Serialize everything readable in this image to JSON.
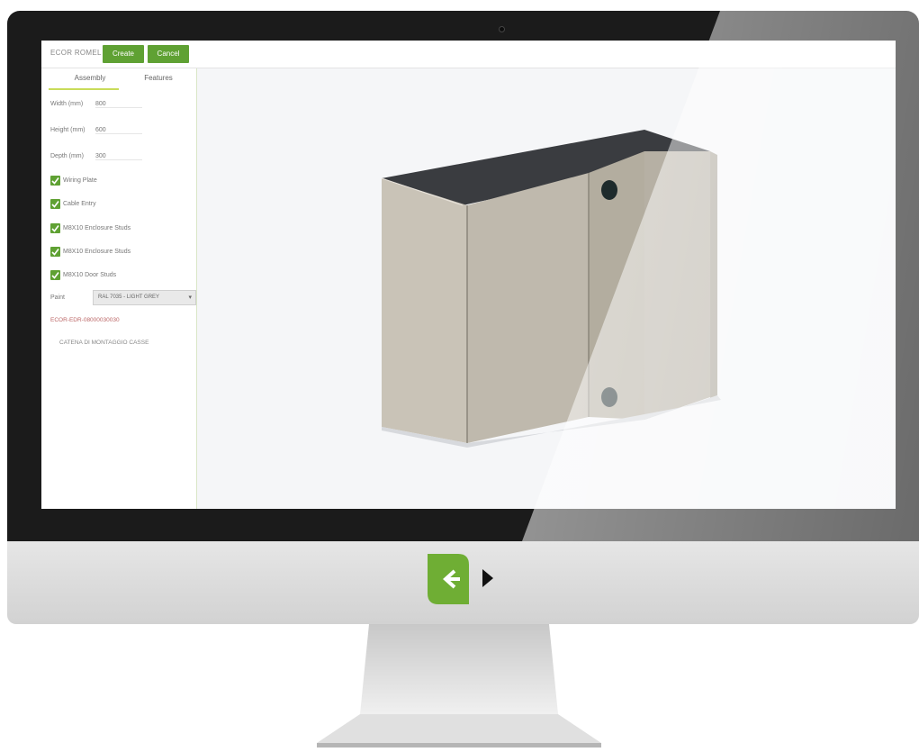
{
  "app": {
    "title": "ECOR ROMEL",
    "create_label": "Create",
    "cancel_label": "Cancel"
  },
  "tabs": [
    {
      "label": "Assembly",
      "active": true
    },
    {
      "label": "Features",
      "active": false
    }
  ],
  "fields": {
    "width": {
      "label": "Width (mm)",
      "value": "800"
    },
    "height": {
      "label": "Height (mm)",
      "value": "600"
    },
    "depth": {
      "label": "Depth (mm)",
      "value": "300"
    }
  },
  "options": [
    {
      "label": "Wiring Plate",
      "checked": true
    },
    {
      "label": "Cable Entry",
      "checked": true
    },
    {
      "label": "M8X10 Enclosure Studs",
      "checked": true
    },
    {
      "label": "M8X10 Enclosure Studs",
      "checked": true
    },
    {
      "label": "M8X10 Door Studs",
      "checked": true
    }
  ],
  "finish": {
    "label": "Paint",
    "selected": "RAL 7035 - LIGHT GREY"
  },
  "code_text": "ECOR-EDR-08000030030",
  "assembly_text": "CATENA DI MONTAGGIO CASSE",
  "colors": {
    "accent_green": "#5fa133",
    "tab_underline": "#c9dc5a",
    "viewport_bg": "#f5f6f8"
  },
  "icons": {
    "logo": "green-arrow-left-logo",
    "next": "play-right-icon",
    "viewcube": "viewcube-icon"
  }
}
